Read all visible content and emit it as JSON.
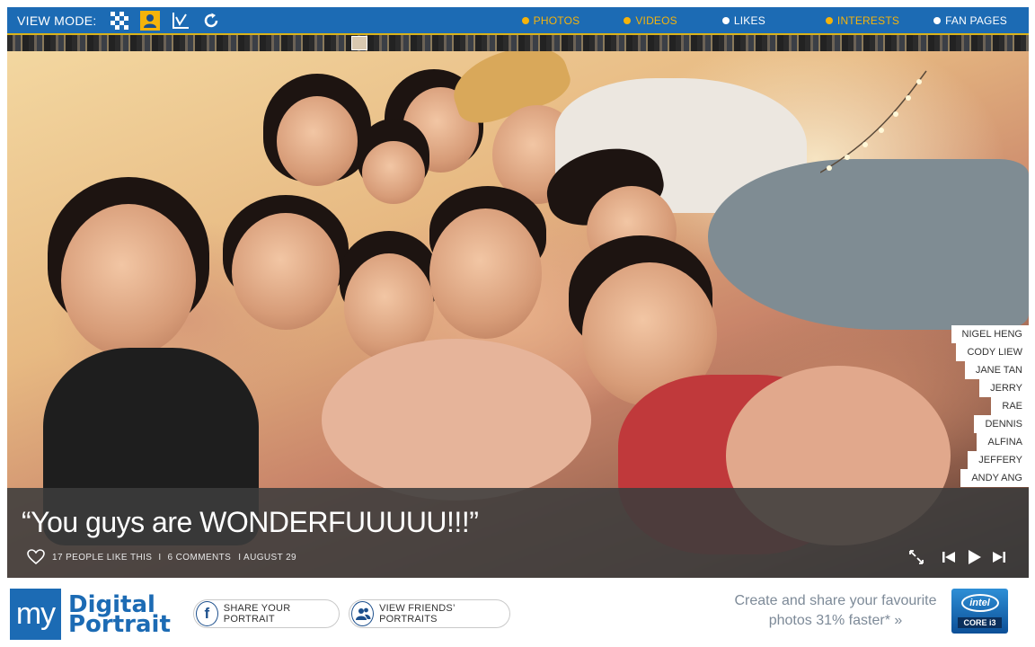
{
  "topbar": {
    "view_mode_label": "VIEW MODE:",
    "view_modes": [
      "mosaic-icon",
      "portrait-icon",
      "chart-icon",
      "refresh-icon"
    ],
    "active_view_mode": "portrait-icon",
    "nav": [
      {
        "label": "PHOTOS",
        "dot_color": "#f5b30b",
        "text_color": "#f5b30b"
      },
      {
        "label": "VIDEOS",
        "dot_color": "#f5b30b",
        "text_color": "#f5b30b"
      },
      {
        "label": "LIKES",
        "dot_color": "#ffffff",
        "text_color": "#ffffff"
      },
      {
        "label": "INTERESTS",
        "dot_color": "#f5b30b",
        "text_color": "#f5b30b"
      },
      {
        "label": "FAN PAGES",
        "dot_color": "#ffffff",
        "text_color": "#ffffff"
      }
    ]
  },
  "tags": [
    "NIGEL HENG",
    "CODY LIEW",
    "JANE TAN",
    "JERRY",
    "RAE",
    "DENNIS",
    "ALFINA",
    "JEFFERY",
    "ANDY ANG"
  ],
  "caption": {
    "quote": "“You guys are WONDERFUUUUU!!!”",
    "likes": "17 PEOPLE LIKE THIS",
    "comments": "6 COMMENTS",
    "date": "I AUGUST 29",
    "separator": "I"
  },
  "footer": {
    "logo_my": "my",
    "logo_line1": "Digital",
    "logo_line2": "Portrait",
    "share_label": "SHARE YOUR PORTRAIT",
    "friends_label": "VIEW FRIENDS’ PORTRAITS",
    "promo_line1": "Create and share your favourite",
    "promo_line2": "photos 31% faster* »",
    "intel_brand": "intel",
    "intel_core": "CORE i3"
  },
  "colors": {
    "brand_blue": "#1c6bb4",
    "accent_yellow": "#f5b30b"
  }
}
